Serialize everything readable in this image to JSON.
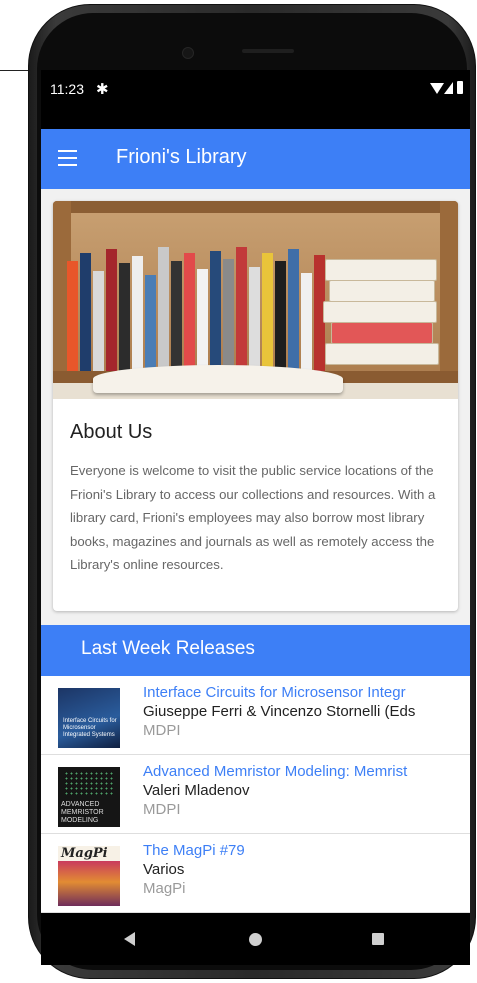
{
  "status_bar": {
    "time": "11:23"
  },
  "app_bar": {
    "title": "Frioni's Library"
  },
  "about": {
    "title": "About Us",
    "text": "Everyone is welcome to visit the public service locations of the Frioni's Library to access our collections and resources. With a library card, Frioni's employees may also borrow most library books, magazines and journals as well as remotely access the Library's online resources."
  },
  "releases": {
    "title": "Last Week Releases",
    "items": [
      {
        "title": "Interface Circuits for Microsensor Integr",
        "author": "Giuseppe Ferri & Vincenzo Stornelli (Eds",
        "publisher": "MDPI",
        "cover_text": "Interface Circuits for Microsensor Integrated Systems"
      },
      {
        "title": "Advanced Memristor Modeling: Memrist",
        "author": "Valeri Mladenov",
        "publisher": "MDPI",
        "cover_text": "ADVANCED MEMRISTOR MODELING"
      },
      {
        "title": "The MagPi #79",
        "author": "Varios",
        "publisher": "MagPi",
        "cover_text": "MagPi"
      }
    ]
  },
  "colors": {
    "accent": "#3d7ff6",
    "link": "#3d7ff6",
    "muted": "#9a9a9a"
  },
  "icons": [
    "gear-icon",
    "wifi-icon",
    "signal-icon",
    "battery-icon",
    "menu-icon",
    "nav-back-icon",
    "nav-home-icon",
    "nav-recents-icon"
  ]
}
